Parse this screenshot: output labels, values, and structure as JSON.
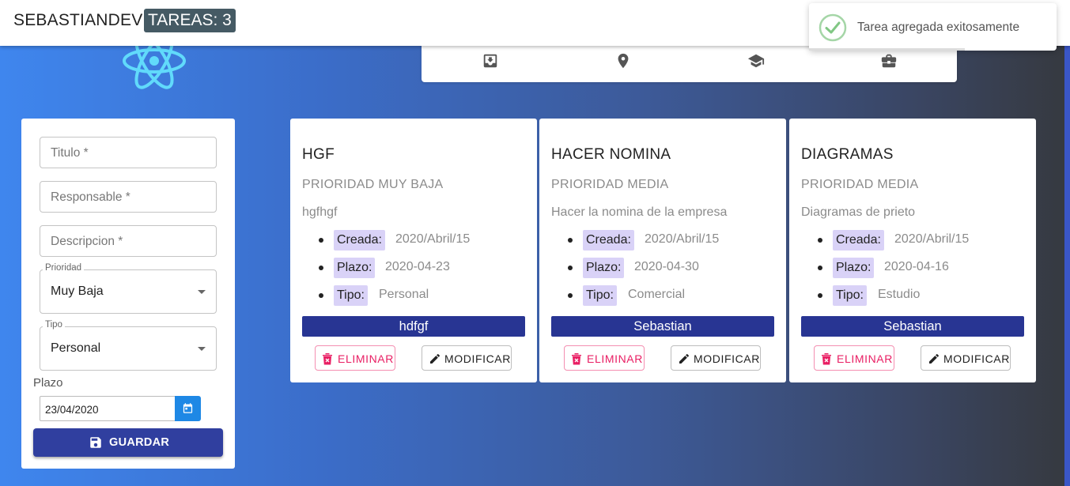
{
  "header": {
    "brand": "SEBASTIANDEV",
    "tasks_badge": "TAREAS: 3"
  },
  "toast": {
    "message": "Tarea agregada exitosamente",
    "icon": "check-circle-icon",
    "accent": "#4caf50"
  },
  "navbar": {
    "icons": [
      "inbox-icon",
      "location-pin-icon",
      "graduation-cap-icon",
      "briefcase-icon"
    ]
  },
  "form": {
    "titulo_placeholder": "Titulo *",
    "responsable_placeholder": "Responsable *",
    "descripcion_placeholder": "Descripcion *",
    "prioridad_label": "Prioridad",
    "prioridad_value": "Muy Baja",
    "tipo_label": "Tipo",
    "tipo_value": "Personal",
    "plazo_label": "Plazo",
    "plazo_value": "23/04/2020",
    "save_label": "GUARDAR"
  },
  "cards": [
    {
      "title": "HGF",
      "priority": "PRIORIDAD MUY BAJA",
      "description": "hgfhgf",
      "created_label": "Creada:",
      "created": "2020/Abril/15",
      "deadline_label": "Plazo:",
      "deadline": "2020-04-23",
      "type_label": "Tipo:",
      "type": "Personal",
      "owner": "hdfgf",
      "delete_label": "ELIMINAR",
      "modify_label": "MODIFICAR"
    },
    {
      "title": "HACER NOMINA",
      "priority": "PRIORIDAD MEDIA",
      "description": "Hacer la nomina de la empresa",
      "created_label": "Creada:",
      "created": "2020/Abril/15",
      "deadline_label": "Plazo:",
      "deadline": "2020-04-30",
      "type_label": "Tipo:",
      "type": "Comercial",
      "owner": "Sebastian",
      "delete_label": "ELIMINAR",
      "modify_label": "MODIFICAR"
    },
    {
      "title": "DIAGRAMAS",
      "priority": "PRIORIDAD MEDIA",
      "description": "Diagramas de prieto",
      "created_label": "Creada:",
      "created": "2020/Abril/15",
      "deadline_label": "Plazo:",
      "deadline": "2020-04-16",
      "type_label": "Tipo:",
      "type": "Estudio",
      "owner": "Sebastian",
      "delete_label": "ELIMINAR",
      "modify_label": "MODIFICAR"
    }
  ]
}
